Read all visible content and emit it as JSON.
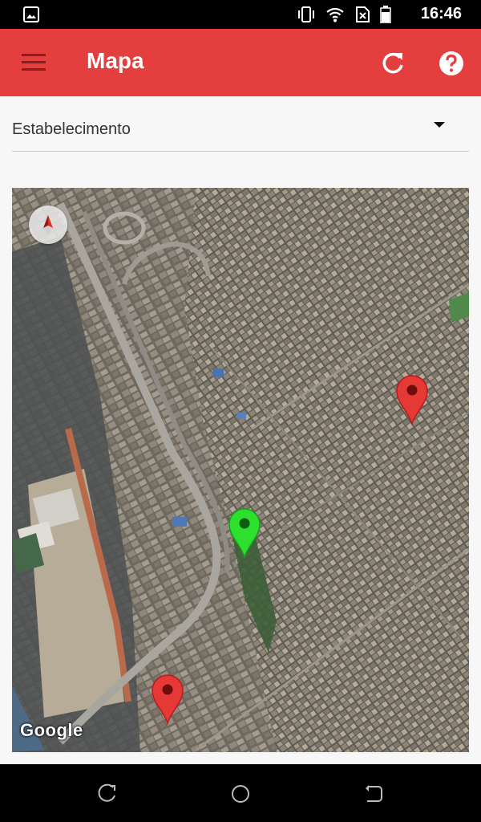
{
  "status_bar": {
    "time": "16:46",
    "icons": [
      "image-icon",
      "vibrate-icon",
      "wifi-icon",
      "no-sim-icon",
      "battery-icon"
    ]
  },
  "app_bar": {
    "title": "Mapa",
    "menu_icon": "menu-icon",
    "refresh_icon": "refresh-icon",
    "help_icon": "help-icon",
    "color": "#e53e3e"
  },
  "selector": {
    "value": "Estabelecimento"
  },
  "map": {
    "attribution": "Google",
    "markers": [
      {
        "color": "red",
        "icon": "red-marker-icon"
      },
      {
        "color": "green",
        "icon": "green-marker-icon"
      },
      {
        "color": "red",
        "icon": "red-marker-icon"
      }
    ]
  },
  "nav_bar": {
    "icons": [
      "recent-apps-icon",
      "home-icon",
      "back-icon"
    ]
  }
}
